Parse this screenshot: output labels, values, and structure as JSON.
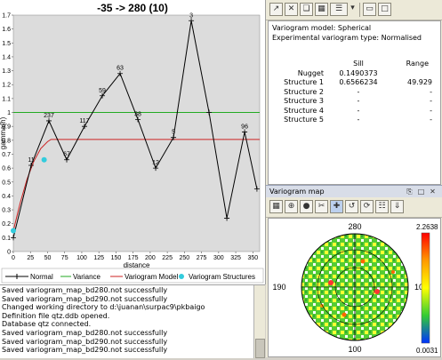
{
  "chart_data": {
    "type": "line",
    "title": "-35 -> 280 (10)",
    "xlabel": "distance",
    "ylabel": "gamma(h)",
    "xlim": [
      0,
      360
    ],
    "ylim": [
      0,
      1.7
    ],
    "x_ticks": [
      0,
      25,
      50,
      75,
      100,
      125,
      150,
      175,
      200,
      225,
      250,
      275,
      300,
      325,
      350
    ],
    "y_ticks": [
      0,
      0.1,
      0.2,
      0.3,
      0.4,
      0.5,
      0.6,
      0.7,
      0.8,
      0.9,
      1,
      1.1,
      1.2,
      1.3,
      1.4,
      1.5,
      1.6,
      1.7
    ],
    "series": [
      {
        "name": "Normal",
        "color": "#000000",
        "x": [
          0,
          26,
          52,
          78,
          104,
          130,
          156,
          182,
          208,
          234,
          260,
          286,
          312,
          338,
          356
        ],
        "y": [
          0.1,
          0.62,
          0.94,
          0.66,
          0.9,
          1.12,
          1.28,
          0.95,
          0.6,
          0.82,
          1.66,
          1.0,
          0.24,
          0.86,
          0.45
        ],
        "labels": [
          "",
          "11",
          "237",
          "67",
          "117",
          "59",
          "63",
          "38",
          "12",
          "5",
          "3",
          "",
          "",
          "96",
          ""
        ]
      },
      {
        "name": "Variance",
        "color": "#22aa22",
        "value": 1.0
      },
      {
        "name": "Variogram Model",
        "color": "#cc2222",
        "x": [
          0,
          5,
          10,
          20,
          30,
          40,
          50,
          55,
          360
        ],
        "y": [
          0.149,
          0.25,
          0.35,
          0.52,
          0.65,
          0.74,
          0.79,
          0.806,
          0.806
        ]
      },
      {
        "name": "Variogram Structures",
        "color": "#33ccdd",
        "x": [
          0,
          45
        ],
        "y": [
          0.15,
          0.66
        ]
      }
    ],
    "grid": false,
    "legend_position": "bottom"
  },
  "info": {
    "model_line": "Variogram model: Spherical",
    "type_line": "Experimental variogram type: Normalised",
    "col_sill": "Sill",
    "col_range": "Range",
    "rows": [
      {
        "label": "Nugget",
        "sill": "0.1490373",
        "range": ""
      },
      {
        "label": "Structure 1",
        "sill": "0.6566234",
        "range": "49.929"
      },
      {
        "label": "Structure 2",
        "sill": "-",
        "range": "-"
      },
      {
        "label": "Structure 3",
        "sill": "-",
        "range": "-"
      },
      {
        "label": "Structure 4",
        "sill": "-",
        "range": "-"
      },
      {
        "label": "Structure 5",
        "sill": "-",
        "range": "-"
      }
    ]
  },
  "vmap": {
    "title": "Variogram map",
    "n_label": "280",
    "s_label": "100",
    "w_label": "190",
    "e_label": "10",
    "scale_max": "2.2638",
    "scale_min": "0.0031"
  },
  "log": {
    "lines": [
      "Saved variogram_map_bd280.not successfully",
      "Saved variogram_map_bd290.not successfully",
      "Changed working directory to d:\\juanan\\surpac9\\pkbaigo",
      "Definition file qtz.ddb opened.",
      "Database qtz connected.",
      "Saved variogram_map_bd280.not successfully",
      "Saved variogram_map_bd290.not successfully",
      "Saved variogram_map_bd290.not successfully"
    ]
  },
  "icons": {
    "top_toolbar": [
      "export-icon",
      "close-icon",
      "copy-icon",
      "paste-icon",
      "grid-icon",
      "dropdown-icon",
      "restore-icon",
      "maximize-icon"
    ],
    "vmap_toolbar": [
      "map-grid-icon",
      "zoom-icon",
      "palette-icon",
      "cut-icon",
      "select-icon",
      "fit-icon",
      "rotate-icon",
      "layers-icon",
      "export-map-icon"
    ]
  }
}
